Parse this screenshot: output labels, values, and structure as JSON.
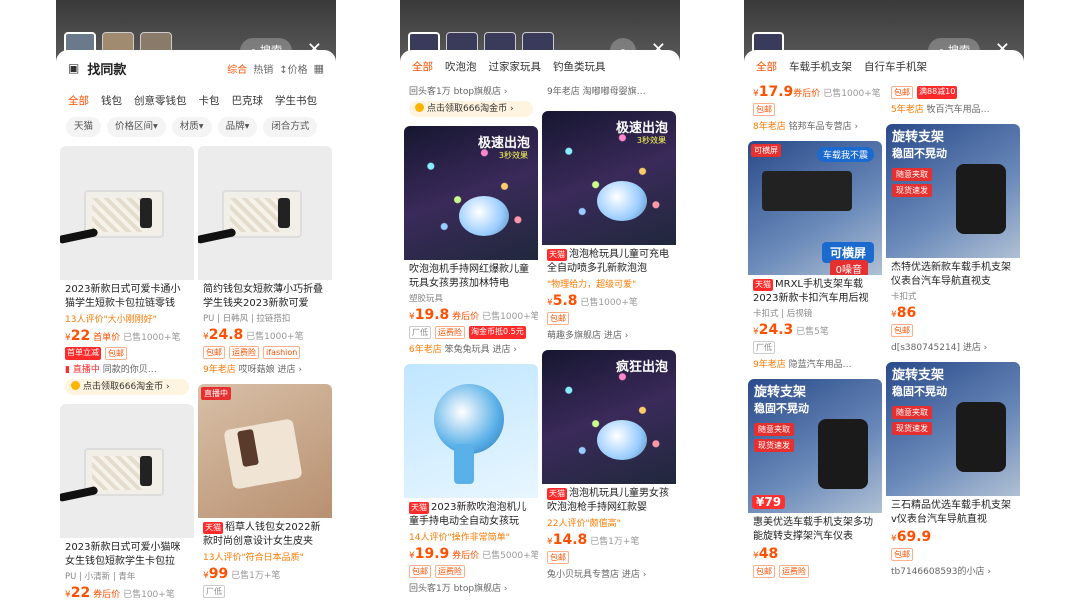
{
  "p1": {
    "top": {
      "search_label": "搜索",
      "close": "✕"
    },
    "title": "找同款",
    "sort": [
      "综合",
      "热销",
      "↕价格"
    ],
    "cats": [
      "全部",
      "钱包",
      "创意零钱包",
      "卡包",
      "巴克球",
      "学生书包"
    ],
    "filters": [
      "天猫",
      "价格区间▾",
      "材质▾",
      "品牌▾",
      "闭合方式"
    ],
    "cards": [
      {
        "title": "2023新款日式可爱卡通小猫学生短款卡包拉链零钱",
        "review": "13人评价\"大小刚刚好\"",
        "yen": "¥",
        "price": "22",
        "tag": "首单价",
        "sold": "已售1000+笔",
        "badge1": "首单立减",
        "badge2": "包邮",
        "live": "直播中",
        "live_text": "同款的你贝…",
        "coin": "点击领取666淘金币"
      },
      {
        "title": "简约钱包女短款薄小巧折叠学生钱夹2023新款可爱",
        "spec": "PU | 日韩风 | 拉链搭扣",
        "yen": "¥",
        "price": "24.8",
        "sold": "已售1000+笔",
        "badge1": "包邮",
        "badge2": "运费险",
        "badge3": "ifashion",
        "shop_old": "9年老店",
        "shop": "哎呀菇娘 进店 ›"
      },
      {
        "title": "2023新款日式可爱小猫咪女生钱包短款学生卡包拉",
        "spec": "PU | 小清新 | 青年",
        "yen": "¥",
        "price": "22",
        "tag": "券后价",
        "sold": "已售100+笔"
      },
      {
        "live_tag": "直播中",
        "mall": "天猫",
        "title": "稻草人钱包女2022新款时尚创意设计女生皮夹",
        "review": "13人评价\"符合日本品质\"",
        "yen": "¥",
        "price": "99",
        "sold": "已售1万+笔",
        "badge1": "厂低"
      }
    ]
  },
  "p2": {
    "cats": [
      "全部",
      "吹泡泡",
      "过家家玩具",
      "钓鱼类玩具"
    ],
    "strip_left": "回头客1万 btop旗舰店 ›",
    "strip_right": "9年老店 淘嘟嘟母婴旗…",
    "coin": "点击领取666淘金币",
    "cards": [
      {
        "img_big": "极速出泡",
        "img_sub": "3秒效果",
        "title": "吹泡泡机手持网红爆款儿童玩具女孩男孩加林特电",
        "spec": "塑胶玩具",
        "yen": "¥",
        "price": "19.8",
        "tag": "券后价",
        "sold": "已售1000+笔",
        "badge1": "厂低",
        "badge2": "运费险",
        "badge3": "淘金币抵0.5元",
        "shop_old": "6年老店",
        "shop": "笨兔兔玩具 进店 ›"
      },
      {
        "img_big": "极速出泡",
        "img_sub": "3秒效果",
        "mall": "天猫",
        "title": "泡泡枪玩具儿童可充电全自动喷多孔新款泡泡",
        "review": "\"物理给力，超级可爱\"",
        "yen": "¥",
        "price": "5.8",
        "sold": "已售1000+笔",
        "badge1": "包邮",
        "shop": "萌趣多旗舰店 进店 ›"
      },
      {
        "img_big": "",
        "mall": "天猫",
        "title": "2023新款吹泡泡机儿童手持电动全自动女孩玩",
        "review": "14人评价\"操作非常简单\"",
        "yen": "¥",
        "price": "19.9",
        "tag": "券后价",
        "sold": "已售5000+笔",
        "badge1": "包邮",
        "badge2": "运费险",
        "strip": "回头客1万 btop旗舰店 ›"
      },
      {
        "img_big": "疯狂出泡",
        "mall": "天猫",
        "title": "泡泡机玩具儿童男女孩吹泡泡枪手持网红款婴",
        "review": "22人评价\"颇值高\"",
        "yen": "¥",
        "price": "14.8",
        "sold": "已售1万+笔",
        "badge1": "包邮",
        "shop": "兔小贝玩具专营店 进店 ›"
      }
    ]
  },
  "p3": {
    "cats": [
      "全部",
      "车载手机支架",
      "自行车手机架"
    ],
    "strip_left_price": "17.9",
    "strip_left_tag": "券后价",
    "strip_left_sold": "已售1000+笔",
    "strip_left_badge": "包邮",
    "strip_left_shop_old": "8年老店",
    "strip_left_shop": "铭邦车品专营店 ›",
    "strip_right_badge1": "包邮",
    "strip_right_badge2": "满88减10",
    "strip_right_shop_old": "5年老店",
    "strip_right_shop": "牧百汽车用品…",
    "cards": [
      {
        "img_tag": "可横屏",
        "img_tag2": "0噪音",
        "img_corner": "可横屏",
        "img_top": "车载我不震",
        "mall": "天猫",
        "title": "MRXL手机支架车载2023新款卡扣汽车用后视",
        "spec": "卡扣式 | 后视镜",
        "yen": "¥",
        "price": "24.3",
        "sold": "已售5笔",
        "badge1": "厂低",
        "shop_old": "9年老店",
        "shop": "隐蓝汽车用品…"
      },
      {
        "img_t1": "旋转支架",
        "img_t2": "稳固不晃动",
        "img_r1": "随意夹取",
        "img_r2": "现货速发",
        "title": "杰特优选新款车载手机支架仪表台汽车导航直视支",
        "spec": "卡扣式",
        "yen": "¥",
        "price": "86",
        "badge1": "包邮",
        "shop": "d[s380745214] 进店 ›"
      },
      {
        "img_t1": "旋转支架",
        "img_t2": "稳固不晃动",
        "img_r1": "随意夹取",
        "img_r2": "现货速发",
        "img_price": "¥79",
        "title": "惠美优选车载手机支架多功能旋转支撑架汽车仪表",
        "yen": "¥",
        "price": "48",
        "badge1": "包邮",
        "badge2": "运费险"
      },
      {
        "img_t1": "旋转支架",
        "img_t2": "稳固不晃动",
        "img_r1": "随意夹取",
        "img_r2": "现货速发",
        "title": "三石精品优选车载手机支架v仪表台汽车导航直视",
        "yen": "¥",
        "price": "69.9",
        "badge1": "包邮",
        "shop": "tb7146608593的小店 ›"
      }
    ]
  }
}
